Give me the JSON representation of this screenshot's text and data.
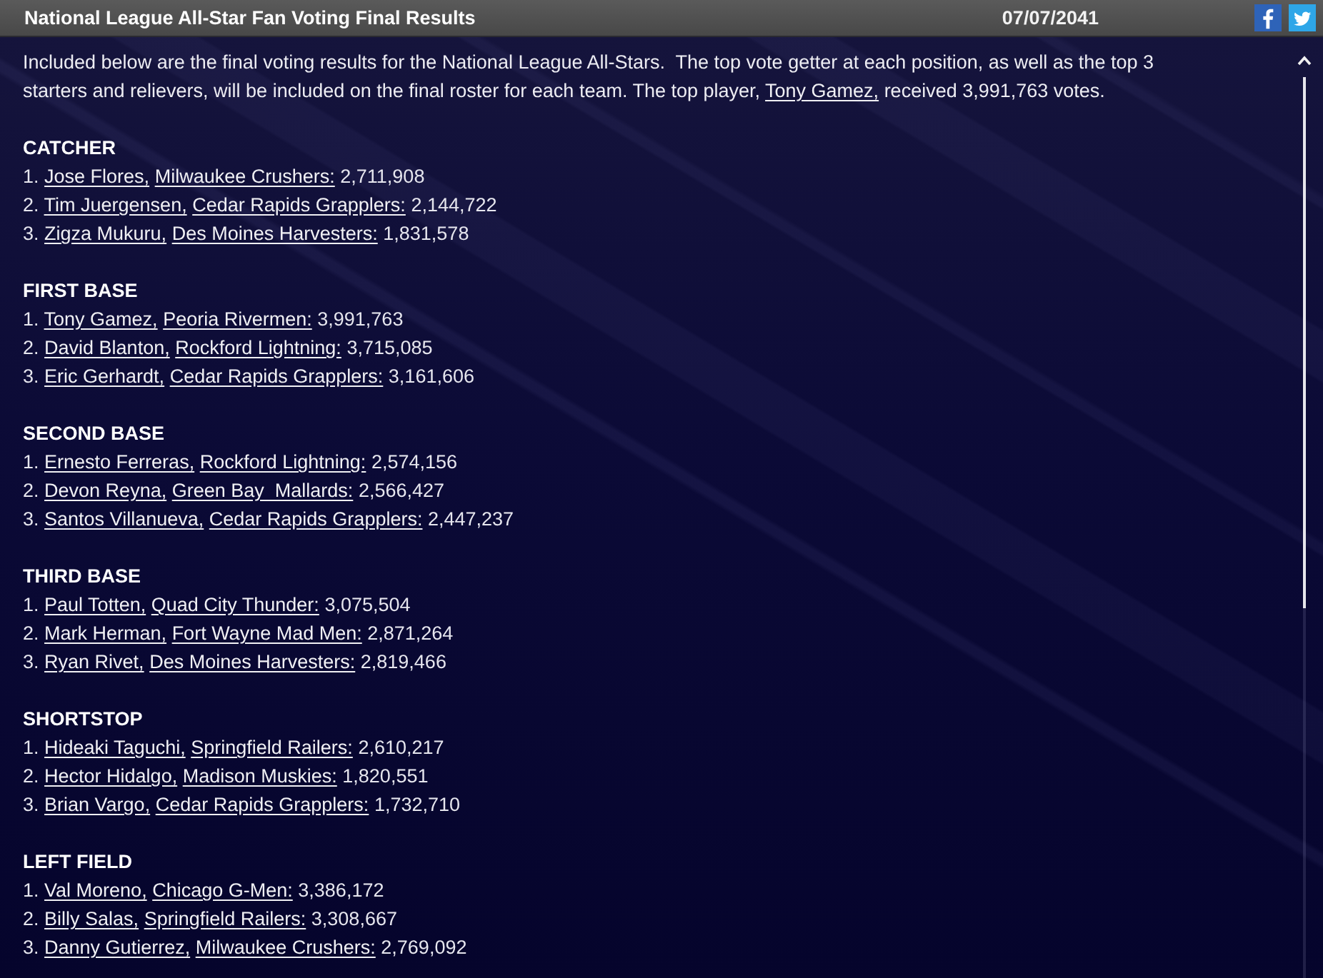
{
  "header": {
    "title": "National League All-Star Fan Voting Final Results",
    "date": "07/07/2041"
  },
  "intro": {
    "text": "Included below are the final voting results for the National League All-Stars.  The top vote getter at each position, as well as the top 3 starters and relievers, will be included on the final roster for each team. The top player, ",
    "link": "Tony Gamez,",
    "after": " received 3,991,763 votes."
  },
  "positions": [
    {
      "heading": "CATCHER",
      "entries": [
        {
          "rank": "1.",
          "player": "Jose Flores,",
          "team": "Milwaukee Crushers:",
          "votes": "2,711,908"
        },
        {
          "rank": "2.",
          "player": "Tim Juergensen,",
          "team": "Cedar Rapids Grapplers:",
          "votes": "2,144,722"
        },
        {
          "rank": "3.",
          "player": "Zigza Mukuru,",
          "team": "Des Moines Harvesters:",
          "votes": "1,831,578"
        }
      ]
    },
    {
      "heading": "FIRST BASE",
      "entries": [
        {
          "rank": "1.",
          "player": "Tony Gamez,",
          "team": "Peoria Rivermen:",
          "votes": "3,991,763"
        },
        {
          "rank": "2.",
          "player": "David Blanton,",
          "team": "Rockford Lightning:",
          "votes": "3,715,085"
        },
        {
          "rank": "3.",
          "player": "Eric Gerhardt,",
          "team": "Cedar Rapids Grapplers:",
          "votes": "3,161,606"
        }
      ]
    },
    {
      "heading": "SECOND BASE",
      "entries": [
        {
          "rank": "1.",
          "player": "Ernesto Ferreras,",
          "team": "Rockford Lightning:",
          "votes": "2,574,156"
        },
        {
          "rank": "2.",
          "player": "Devon Reyna,",
          "team": "Green Bay  Mallards:",
          "votes": "2,566,427"
        },
        {
          "rank": "3.",
          "player": "Santos Villanueva,",
          "team": "Cedar Rapids Grapplers:",
          "votes": "2,447,237"
        }
      ]
    },
    {
      "heading": "THIRD BASE",
      "entries": [
        {
          "rank": "1.",
          "player": "Paul Totten,",
          "team": "Quad City Thunder:",
          "votes": "3,075,504"
        },
        {
          "rank": "2.",
          "player": "Mark Herman,",
          "team": "Fort Wayne Mad Men:",
          "votes": "2,871,264"
        },
        {
          "rank": "3.",
          "player": "Ryan Rivet,",
          "team": "Des Moines Harvesters:",
          "votes": "2,819,466"
        }
      ]
    },
    {
      "heading": "SHORTSTOP",
      "entries": [
        {
          "rank": "1.",
          "player": "Hideaki Taguchi,",
          "team": "Springfield Railers:",
          "votes": "2,610,217"
        },
        {
          "rank": "2.",
          "player": "Hector Hidalgo,",
          "team": "Madison Muskies:",
          "votes": "1,820,551"
        },
        {
          "rank": "3.",
          "player": "Brian Vargo,",
          "team": "Cedar Rapids Grapplers:",
          "votes": "1,732,710"
        }
      ]
    },
    {
      "heading": "LEFT FIELD",
      "entries": [
        {
          "rank": "1.",
          "player": "Val Moreno,",
          "team": "Chicago G-Men:",
          "votes": "3,386,172"
        },
        {
          "rank": "2.",
          "player": "Billy Salas,",
          "team": "Springfield Railers:",
          "votes": "3,308,667"
        },
        {
          "rank": "3.",
          "player": "Danny Gutierrez,",
          "team": "Milwaukee Crushers:",
          "votes": "2,769,092"
        }
      ]
    }
  ]
}
